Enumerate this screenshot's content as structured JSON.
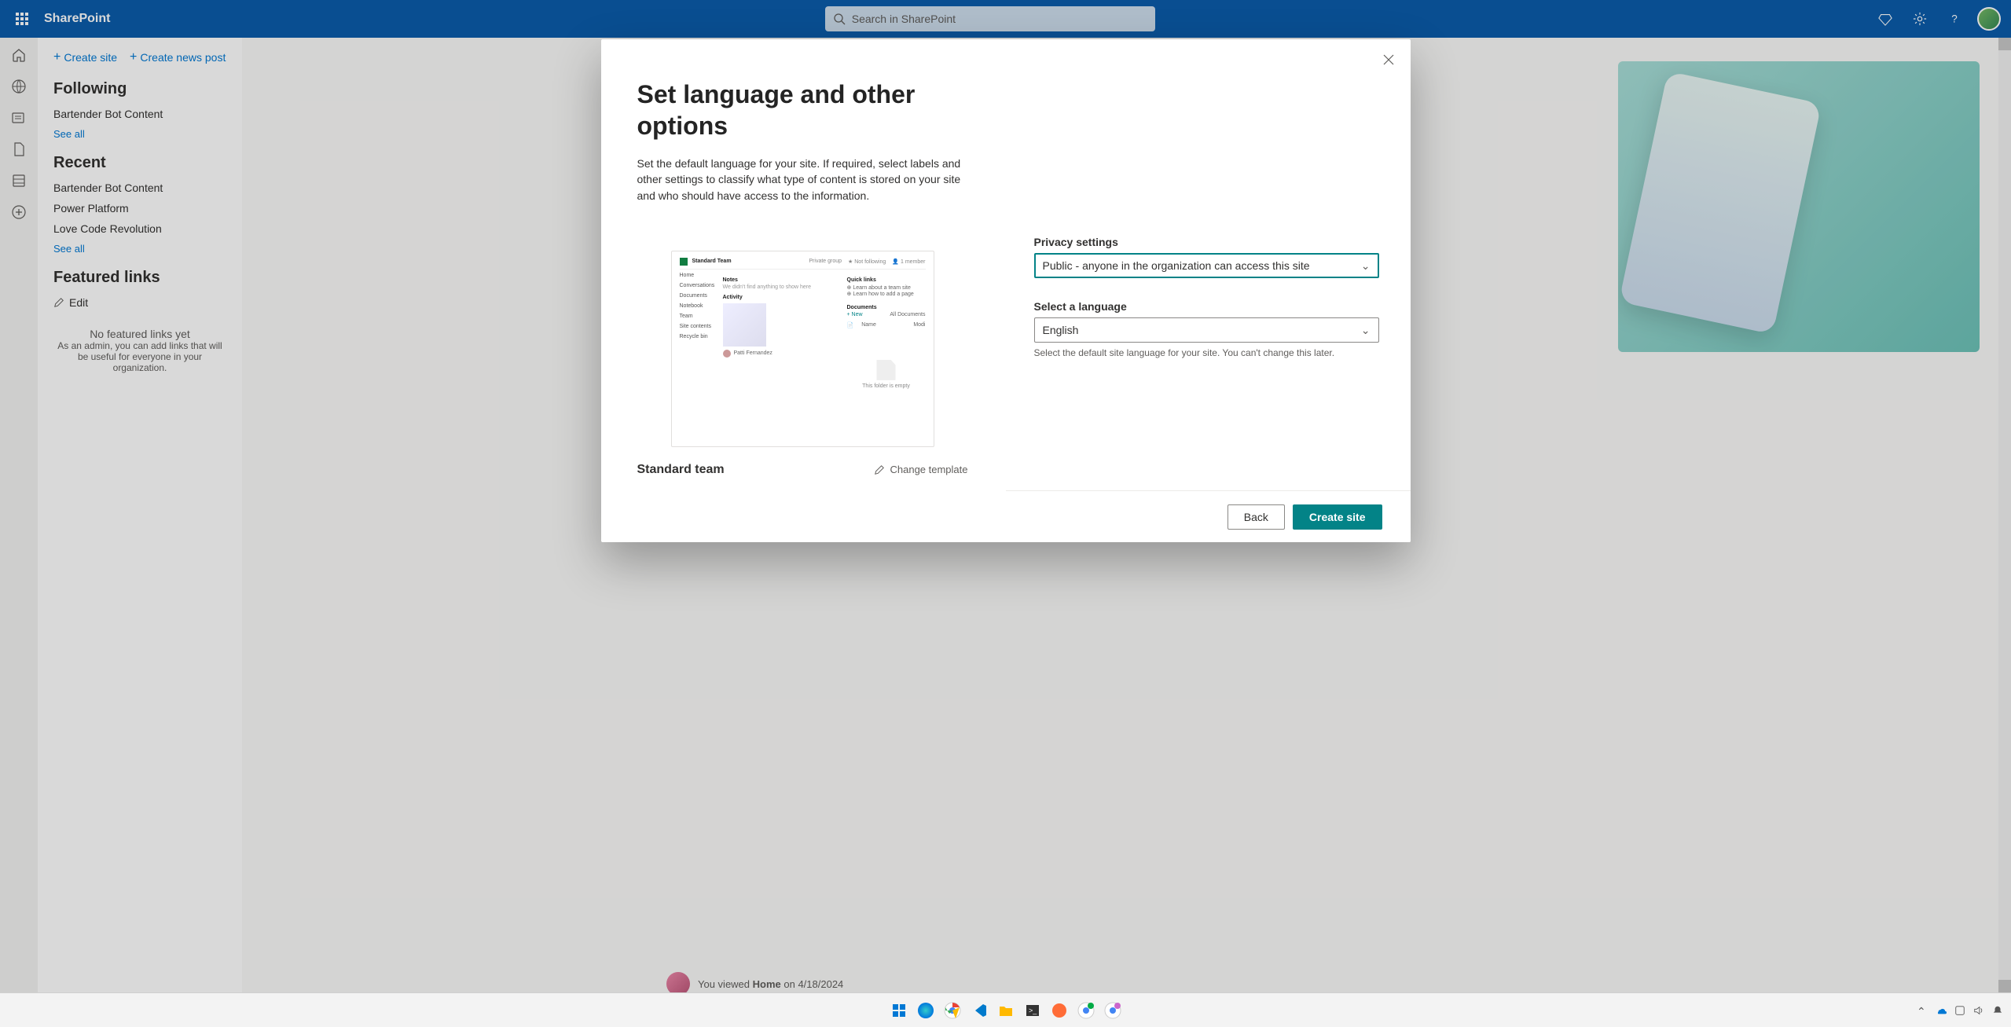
{
  "suite": {
    "app_name": "SharePoint",
    "search_placeholder": "Search in SharePoint"
  },
  "commands": {
    "create_site": "Create site",
    "create_news": "Create news post"
  },
  "nav": {
    "following_h": "Following",
    "following_items": [
      "Bartender Bot Content"
    ],
    "recent_h": "Recent",
    "recent_items": [
      "Bartender Bot Content",
      "Power Platform",
      "Love Code Revolution"
    ],
    "see_all": "See all",
    "featured_h": "Featured links",
    "edit": "Edit",
    "empty_title": "No featured links yet",
    "empty_sub": "As an admin, you can add links that will be useful for everyone in your organization."
  },
  "activity": {
    "prefix": "You viewed ",
    "bold": "Home",
    "suffix": " on 4/18/2024"
  },
  "dialog": {
    "title": "Set language and other options",
    "description": "Set the default language for your site. If required, select labels and other settings to classify what type of content is stored on your site and who should have access to the information.",
    "template_name": "Standard team",
    "change_template": "Change template",
    "preview_title": "Standard Team",
    "preview_nav": [
      "Home",
      "Conversations",
      "Documents",
      "Notebook",
      "Team",
      "Site contents",
      "Recycle bin"
    ],
    "preview_notes_h": "Notes",
    "preview_notes_line": "We didn't find anything to show here",
    "preview_activity_h": "Activity",
    "preview_person": "Patti Fernandez",
    "preview_quick_h": "Quick links",
    "preview_quick_1": "Learn about a team site",
    "preview_quick_2": "Learn how to add a page",
    "preview_docs_h": "Documents",
    "preview_docs_new": "+ New",
    "preview_docs_all": "All Documents",
    "preview_docs_name": "Name",
    "preview_docs_mod": "Modi",
    "preview_folder_empty": "This folder is empty",
    "privacy_label": "Privacy settings",
    "privacy_value": "Public - anyone in the organization can access this site",
    "language_label": "Select a language",
    "language_value": "English",
    "language_helper": "Select the default site language for your site. You can't change this later.",
    "btn_back": "Back",
    "btn_create": "Create site"
  }
}
